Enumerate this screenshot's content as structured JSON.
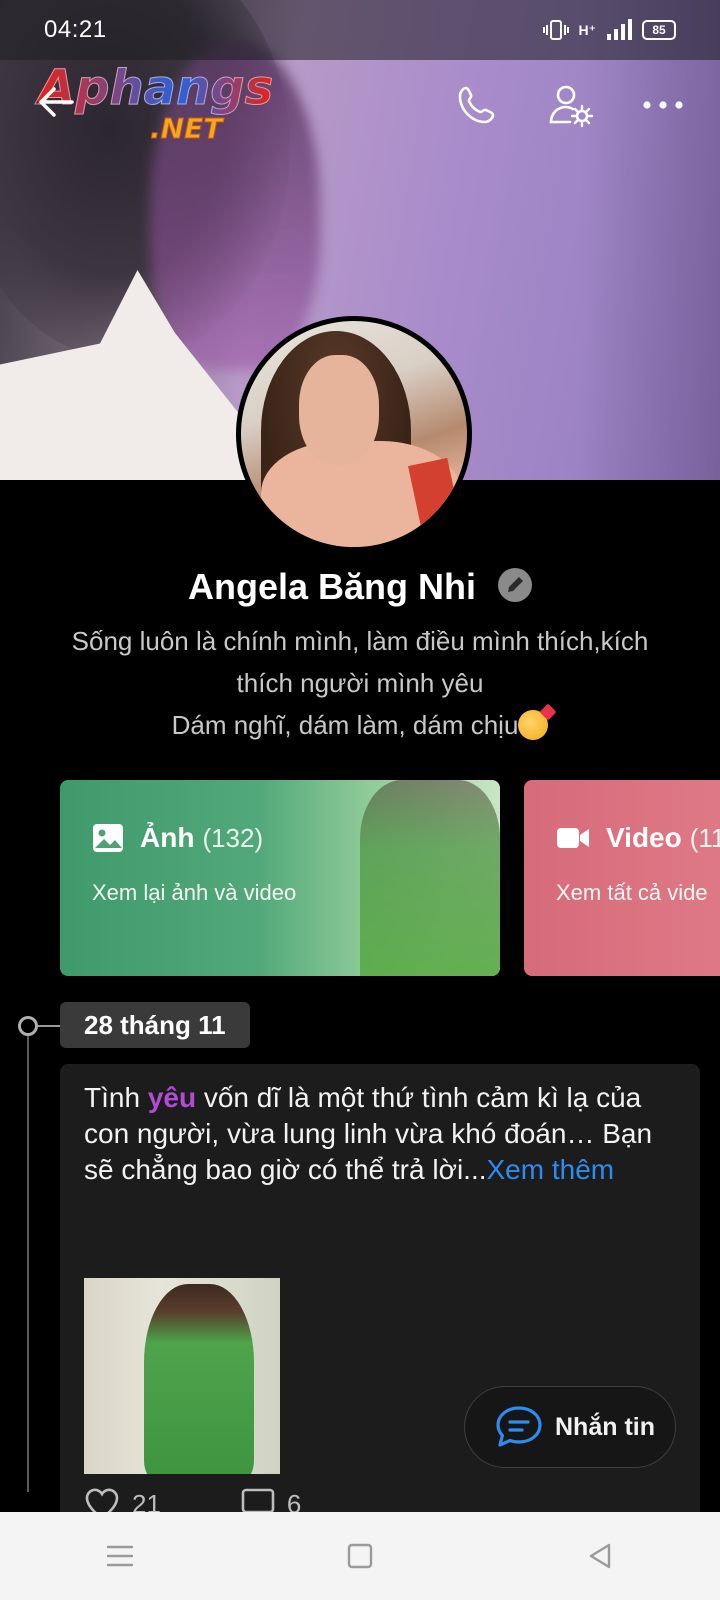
{
  "status_bar": {
    "time": "04:21",
    "network": "H⁺",
    "battery": "85"
  },
  "watermark": {
    "line1": "Aphangs",
    "line2": ".NET"
  },
  "top_bar": {
    "back_icon": "arrow-left-icon",
    "actions": [
      "phone-icon",
      "user-settings-icon",
      "more-horizontal-icon"
    ]
  },
  "profile": {
    "name": "Angela Băng Nhi",
    "bio_line1": "Sống luôn là chính mình, làm điều mình thích,kích",
    "bio_line2": "thích người mình yêu",
    "bio_line3": "Dám nghĩ, dám làm, dám chịu"
  },
  "media_cards": [
    {
      "title": "Ảnh",
      "count": "(132)",
      "subtitle": "Xem lại ảnh và video",
      "icon": "image-icon",
      "color": "#4da374"
    },
    {
      "title": "Video",
      "count": "(11",
      "subtitle": "Xem tất cả vide",
      "icon": "video-camera-icon",
      "color": "#dc7181"
    }
  ],
  "timeline": {
    "date": "28 tháng 11"
  },
  "post": {
    "text_before": "Tình ",
    "text_highlight": "yêu",
    "text_after": " vốn dĩ là một thứ tình cảm kì lạ của con người, vừa lung linh vừa khó đoán… Bạn sẽ chẳng bao giờ có thể trả lời...",
    "see_more": "Xem thêm",
    "likes": "21",
    "comments": "6"
  },
  "message_button": {
    "label": "Nhắn tin"
  },
  "colors": {
    "accent_blue": "#2d8cf0",
    "highlight_purple": "#b34bd6",
    "photos_card": "#4da374",
    "video_card": "#dc7181"
  }
}
